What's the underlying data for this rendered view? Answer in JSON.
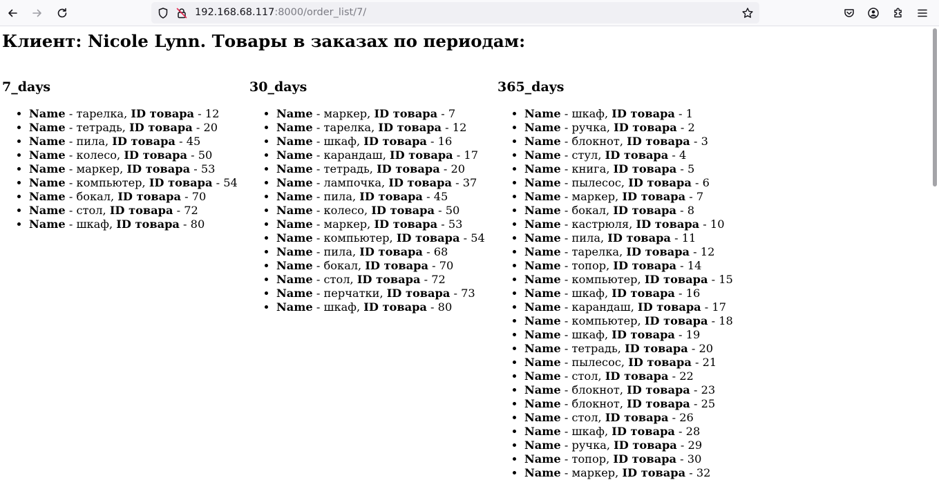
{
  "browser": {
    "url_host": "192.168.68.117",
    "url_rest": ":8000/order_list/7/"
  },
  "page": {
    "title": "Клиент: Nicole Lynn. Товары в заказах по периодам:",
    "name_label": "Name",
    "id_label": "ID товара",
    "periods": [
      {
        "heading": "7_days",
        "items": [
          {
            "name": "тарелка",
            "id": "12"
          },
          {
            "name": "тетрадь",
            "id": "20"
          },
          {
            "name": "пила",
            "id": "45"
          },
          {
            "name": "колесо",
            "id": "50"
          },
          {
            "name": "маркер",
            "id": "53"
          },
          {
            "name": "компьютер",
            "id": "54"
          },
          {
            "name": "бокал",
            "id": "70"
          },
          {
            "name": "стол",
            "id": "72"
          },
          {
            "name": "шкаф",
            "id": "80"
          }
        ]
      },
      {
        "heading": "30_days",
        "items": [
          {
            "name": "маркер",
            "id": "7"
          },
          {
            "name": "тарелка",
            "id": "12"
          },
          {
            "name": "шкаф",
            "id": "16"
          },
          {
            "name": "карандаш",
            "id": "17"
          },
          {
            "name": "тетрадь",
            "id": "20"
          },
          {
            "name": "лампочка",
            "id": "37"
          },
          {
            "name": "пила",
            "id": "45"
          },
          {
            "name": "колесо",
            "id": "50"
          },
          {
            "name": "маркер",
            "id": "53"
          },
          {
            "name": "компьютер",
            "id": "54"
          },
          {
            "name": "пила",
            "id": "68"
          },
          {
            "name": "бокал",
            "id": "70"
          },
          {
            "name": "стол",
            "id": "72"
          },
          {
            "name": "перчатки",
            "id": "73"
          },
          {
            "name": "шкаф",
            "id": "80"
          }
        ]
      },
      {
        "heading": "365_days",
        "items": [
          {
            "name": "шкаф",
            "id": "1"
          },
          {
            "name": "ручка",
            "id": "2"
          },
          {
            "name": "блокнот",
            "id": "3"
          },
          {
            "name": "стул",
            "id": "4"
          },
          {
            "name": "книга",
            "id": "5"
          },
          {
            "name": "пылесос",
            "id": "6"
          },
          {
            "name": "маркер",
            "id": "7"
          },
          {
            "name": "бокал",
            "id": "8"
          },
          {
            "name": "кастрюля",
            "id": "10"
          },
          {
            "name": "пила",
            "id": "11"
          },
          {
            "name": "тарелка",
            "id": "12"
          },
          {
            "name": "топор",
            "id": "14"
          },
          {
            "name": "компьютер",
            "id": "15"
          },
          {
            "name": "шкаф",
            "id": "16"
          },
          {
            "name": "карандаш",
            "id": "17"
          },
          {
            "name": "компьютер",
            "id": "18"
          },
          {
            "name": "шкаф",
            "id": "19"
          },
          {
            "name": "тетрадь",
            "id": "20"
          },
          {
            "name": "пылесос",
            "id": "21"
          },
          {
            "name": "стол",
            "id": "22"
          },
          {
            "name": "блокнот",
            "id": "23"
          },
          {
            "name": "блокнот",
            "id": "25"
          },
          {
            "name": "стол",
            "id": "26"
          },
          {
            "name": "шкаф",
            "id": "28"
          },
          {
            "name": "ручка",
            "id": "29"
          },
          {
            "name": "топор",
            "id": "30"
          },
          {
            "name": "маркер",
            "id": "32"
          }
        ]
      }
    ]
  }
}
